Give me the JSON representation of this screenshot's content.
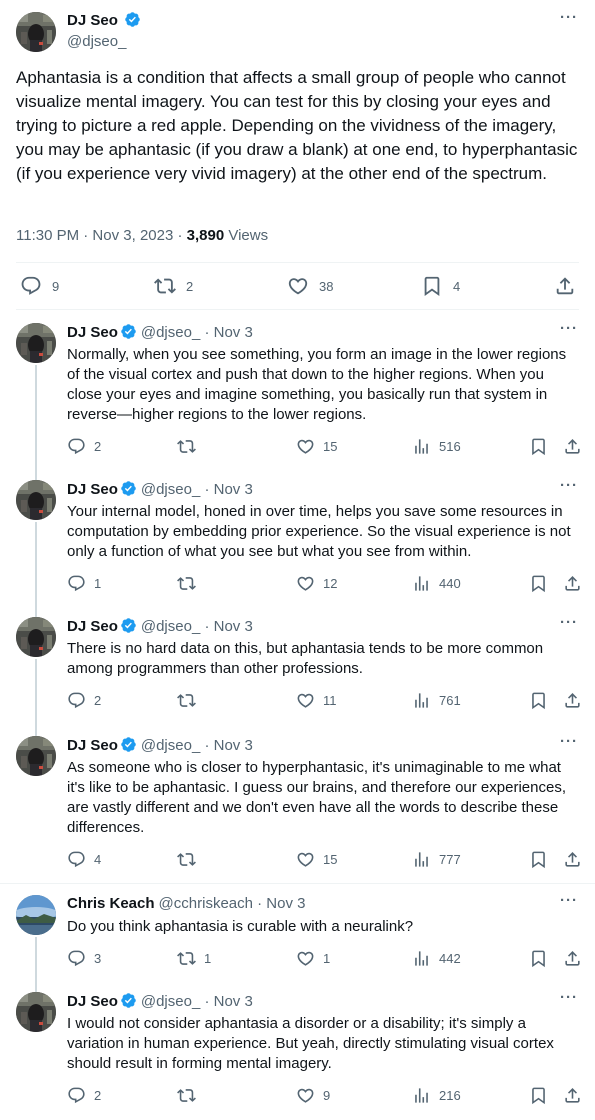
{
  "main": {
    "name": "DJ Seo",
    "handle": "@djseo_",
    "text": "Aphantasia is a condition that affects a small group of people who cannot visualize mental imagery. You can test for this by closing your eyes and trying to picture a red apple. Depending on the vividness of the imagery, you may be aphantasic (if you draw a blank) at one end, to hyperphantasic (if you experience very vivid imagery) at the other end of the spectrum.",
    "timestamp": "11:30 PM · Nov 3, 2023 · ",
    "views_count": "3,890",
    "views_label": " Views",
    "replies": "9",
    "reposts": "2",
    "likes": "38",
    "bookmarks": "4"
  },
  "replies": [
    {
      "name": "DJ Seo",
      "handle": "@djseo_ · Nov 3",
      "text": "Normally, when you see something, you form an image in the lower regions of the visual cortex and push that down to the higher regions. When you close your eyes and imagine something, you basically run that system in reverse—higher regions to the lower regions.",
      "replies": "2",
      "reposts": "",
      "likes": "15",
      "views": "516"
    },
    {
      "name": "DJ Seo",
      "handle": "@djseo_ · Nov 3",
      "text": "Your internal model, honed in over time, helps you save some resources in computation by embedding prior experience. So the visual experience is not only a function of what you see but what you see from within.",
      "replies": "1",
      "reposts": "",
      "likes": "12",
      "views": "440"
    },
    {
      "name": "DJ Seo",
      "handle": "@djseo_ · Nov 3",
      "text": "There is no hard data on this, but aphantasia tends to be more common among programmers than other professions.",
      "replies": "2",
      "reposts": "",
      "likes": "11",
      "views": "761"
    },
    {
      "name": "DJ Seo",
      "handle": "@djseo_ · Nov 3",
      "text": "As someone who is closer to hyperphantasic, it's unimaginable to me what it's like to be aphantasic. I guess our brains, and therefore our experiences, are vastly different and we don't even have all the words to describe these differences.",
      "replies": "4",
      "reposts": "",
      "likes": "15",
      "views": "777"
    },
    {
      "name": "Chris Keach",
      "handle": "@cchriskeach · Nov 3",
      "text": "Do you think aphantasia is curable with a neuralink?",
      "replies": "3",
      "reposts": "1",
      "likes": "1",
      "views": "442"
    },
    {
      "name": "DJ Seo",
      "handle": "@djseo_ · Nov 3",
      "text": "I would not consider aphantasia a disorder or a disability; it's simply a variation in human experience. But yeah, directly stimulating visual cortex should result in forming mental imagery.",
      "replies": "2",
      "reposts": "",
      "likes": "9",
      "views": "216"
    }
  ],
  "icons": {
    "reply": "speech-bubble-icon",
    "repost": "repost-icon",
    "like": "heart-icon",
    "views": "bar-chart-icon",
    "bookmark": "bookmark-icon",
    "share": "share-icon",
    "more": "more-icon",
    "verified": "verified-badge-icon"
  },
  "colors": {
    "verified": "#1d9bf0",
    "secondary_text": "#536471",
    "thread_line": "#cfd9de"
  }
}
